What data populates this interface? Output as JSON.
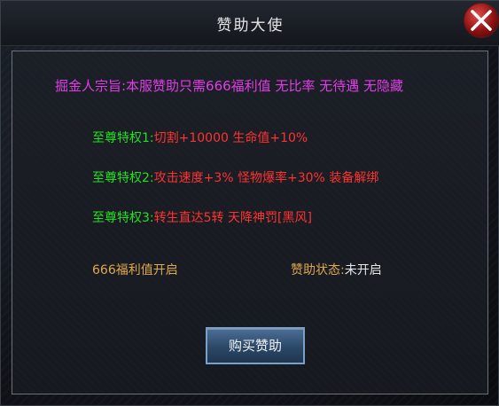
{
  "window": {
    "title": "赞助大使"
  },
  "motto": "掘金人宗旨:本服赞助只需666福利值 无比率 无待遇 无隐藏",
  "privileges": [
    {
      "label": "至尊特权1:",
      "text": "切割+10000 生命值+10%"
    },
    {
      "label": "至尊特权2:",
      "text": "攻击速度+3% 怪物爆率+30% 装备解绑"
    },
    {
      "label": "至尊特权3:",
      "text": "转生直达5转 天降神罚[黑风]"
    }
  ],
  "welfare_text": "666福利值开启",
  "status": {
    "label": "赞助状态:",
    "value": "未开启"
  },
  "buy_button_label": "购买赞助",
  "colors": {
    "motto": "#e23ce8",
    "privilege_label": "#21e021",
    "privilege_text": "#ff3232",
    "info_text": "#e0a84e",
    "button_bg": "#2b4867"
  },
  "icons": {
    "close": "close-icon"
  }
}
